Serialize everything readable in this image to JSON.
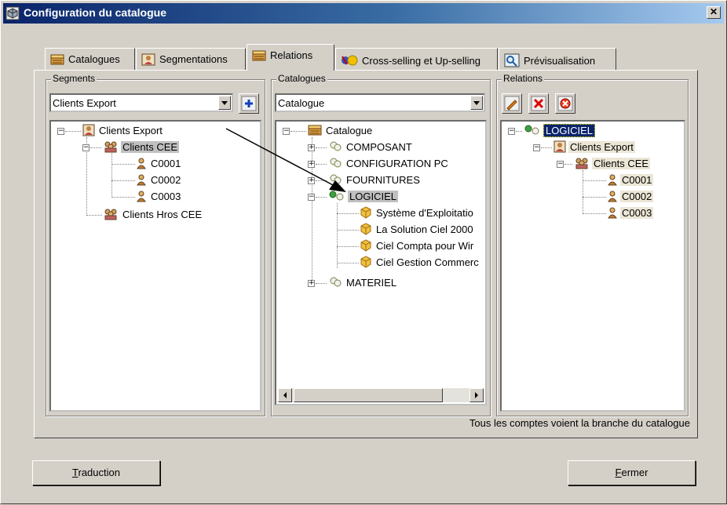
{
  "window": {
    "title": "Configuration du catalogue",
    "close_glyph": "✕"
  },
  "tabs": [
    {
      "label": "Catalogues",
      "icon": "catalog-icon"
    },
    {
      "label": "Segmentations",
      "icon": "segment-icon"
    },
    {
      "label": "Relations",
      "icon": "catalog-icon",
      "active": true
    },
    {
      "label": "Cross-selling et Up-selling",
      "icon": "cross-sell-icon"
    },
    {
      "label": "Prévisualisation",
      "icon": "preview-icon"
    }
  ],
  "segments": {
    "legend": "Segments",
    "combo_value": "Clients Export",
    "tree": {
      "root": "Clients Export",
      "group1": "Clients CEE",
      "items": [
        "C0001",
        "C0002",
        "C0003"
      ],
      "group2": "Clients Hros CEE"
    }
  },
  "catalogues": {
    "legend": "Catalogues",
    "combo_value": "Catalogue",
    "tree": {
      "root": "Catalogue",
      "nodes": [
        "COMPOSANT",
        "CONFIGURATION PC",
        "FOURNITURES",
        "LOGICIEL"
      ],
      "children": [
        "Système d'Exploitatio",
        "La Solution Ciel 2000",
        "Ciel Compta pour Wir",
        "Ciel Gestion Commerc"
      ],
      "last": "MATERIEL"
    }
  },
  "relations": {
    "legend": "Relations",
    "tree": {
      "root": "LOGICIEL",
      "segment": "Clients Export",
      "group": "Clients CEE",
      "items": [
        "C0001",
        "C0002",
        "C0003"
      ]
    }
  },
  "status_text": "Tous les comptes voient la branche du catalogue",
  "buttons": {
    "traduction_first": "T",
    "traduction_rest": "raduction",
    "fermer_first": "F",
    "fermer_rest": "ermer"
  },
  "colors": {
    "title_start": "#0a246a",
    "title_end": "#a6caf0",
    "face": "#d4d0c8",
    "selection": "#0a246a"
  }
}
